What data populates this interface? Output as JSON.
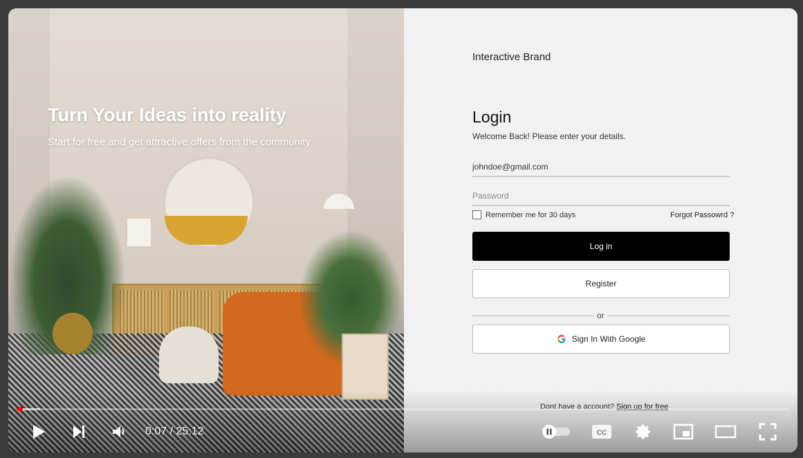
{
  "hero": {
    "headline": "Turn Your Ideas into reality",
    "subline": "Start for free and get attractive offers from the community"
  },
  "form": {
    "brand": "Interactive Brand",
    "title": "Login",
    "welcome": "Welcome Back! Please enter your details.",
    "email_value": "johndoe@gmail.com",
    "password_placeholder": "Password",
    "remember_label": "Remember me for 30 days",
    "forgot_label": "Forgot Passowrd ?",
    "login_label": "Log in",
    "register_label": "Register",
    "or_label": "or",
    "google_label": "Sign In With Google",
    "signup_prompt": "Dont have a account?",
    "signup_link": "Sign up for free"
  },
  "player": {
    "current_time": "0:07",
    "time_separator": " / ",
    "duration": "25:12",
    "progress_fraction": 0.0046,
    "loaded_fraction": 0.03,
    "icons": [
      "play-icon",
      "next-icon",
      "volume-icon",
      "autoplay-toggle-icon",
      "captions-icon",
      "settings-icon",
      "miniplayer-icon",
      "theater-mode-icon",
      "fullscreen-icon"
    ],
    "colors": {
      "progress": "#ff0000",
      "login_button": "#000000"
    }
  }
}
